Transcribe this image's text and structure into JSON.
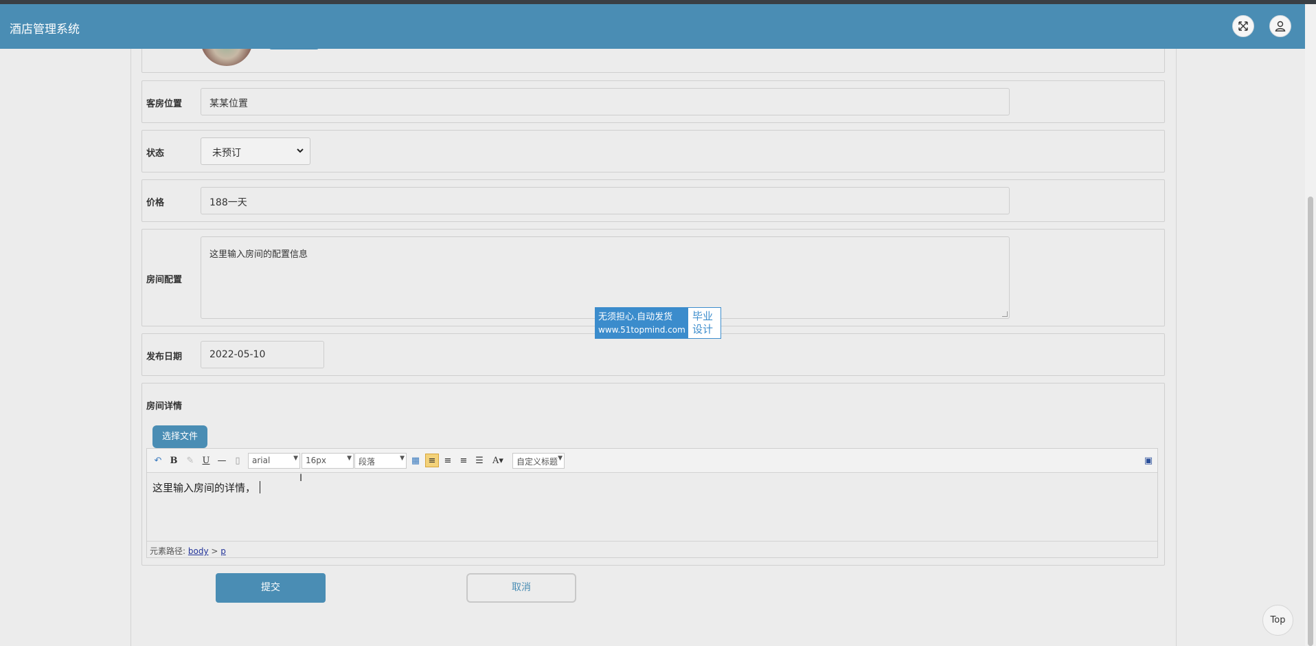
{
  "header": {
    "title": "酒店管理系统",
    "fullscreen_icon": "fullscreen-icon",
    "user_icon": "user-icon"
  },
  "form": {
    "location": {
      "label": "客房位置",
      "value": "某某位置"
    },
    "status": {
      "label": "状态",
      "selected": "未预订"
    },
    "price": {
      "label": "价格",
      "value": "188一天"
    },
    "config": {
      "label": "房间配置",
      "value": "这里输入房间的配置信息"
    },
    "date": {
      "label": "发布日期",
      "value": "2022-05-10"
    },
    "details": {
      "label": "房间详情",
      "file_button": "选择文件",
      "toolbar": {
        "font": "arial",
        "size": "16px",
        "paragraph": "段落",
        "custom_title": "自定义标题"
      },
      "content": "这里输入房间的详情，",
      "path_label": "元素路径:",
      "path_body": "body",
      "path_sep": ">",
      "path_p": "p"
    }
  },
  "watermark": {
    "line1": "无须担心.自动发货",
    "line2": "www.51topmind.com",
    "right1": "毕业",
    "right2": "设计"
  },
  "actions": {
    "submit": "提交",
    "cancel": "取消"
  },
  "top_button": "Top",
  "colors": {
    "header": "#4a8db4",
    "accent": "#4a8db4",
    "watermark": "#3b8ccc"
  }
}
